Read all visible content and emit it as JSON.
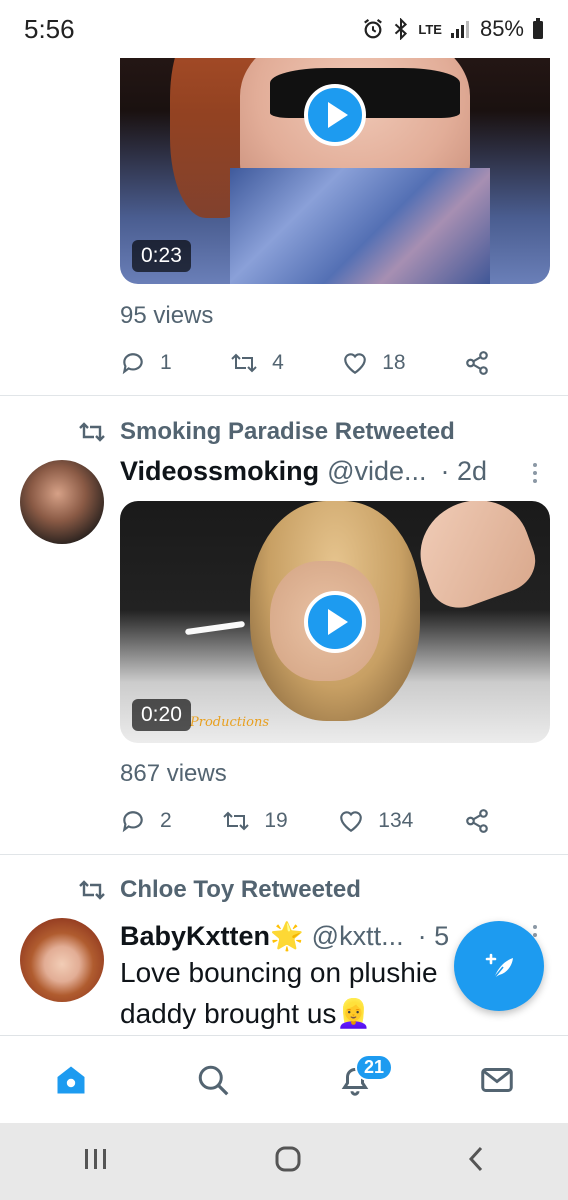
{
  "status_bar": {
    "time": "5:56",
    "network": "LTE",
    "battery": "85%"
  },
  "tweets": [
    {
      "video_duration": "0:23",
      "views": "95 views",
      "replies": "1",
      "retweets": "4",
      "likes": "18"
    },
    {
      "retweeted_by": "Smoking Paradise Retweeted",
      "name": "Videossmoking",
      "handle": "@vide...",
      "time": "· 2d",
      "video_duration": "0:20",
      "watermark": "Productions",
      "views": "867 views",
      "replies": "2",
      "retweets": "19",
      "likes": "134"
    },
    {
      "retweeted_by": "Chloe Toy Retweeted",
      "name": "BabyKxtten",
      "name_emoji": "🌟",
      "handle": "@kxtt...",
      "time": "· 5",
      "text_line1": "Love bouncing on plushie",
      "text_line2": "daddy brought us",
      "text_emoji": "👱‍♀️"
    }
  ],
  "bottom_nav": {
    "items": [
      "home",
      "search",
      "notifications",
      "messages"
    ],
    "notifications_badge": "21"
  },
  "colors": {
    "accent": "#1d9bf0",
    "secondary_text": "#536471"
  }
}
